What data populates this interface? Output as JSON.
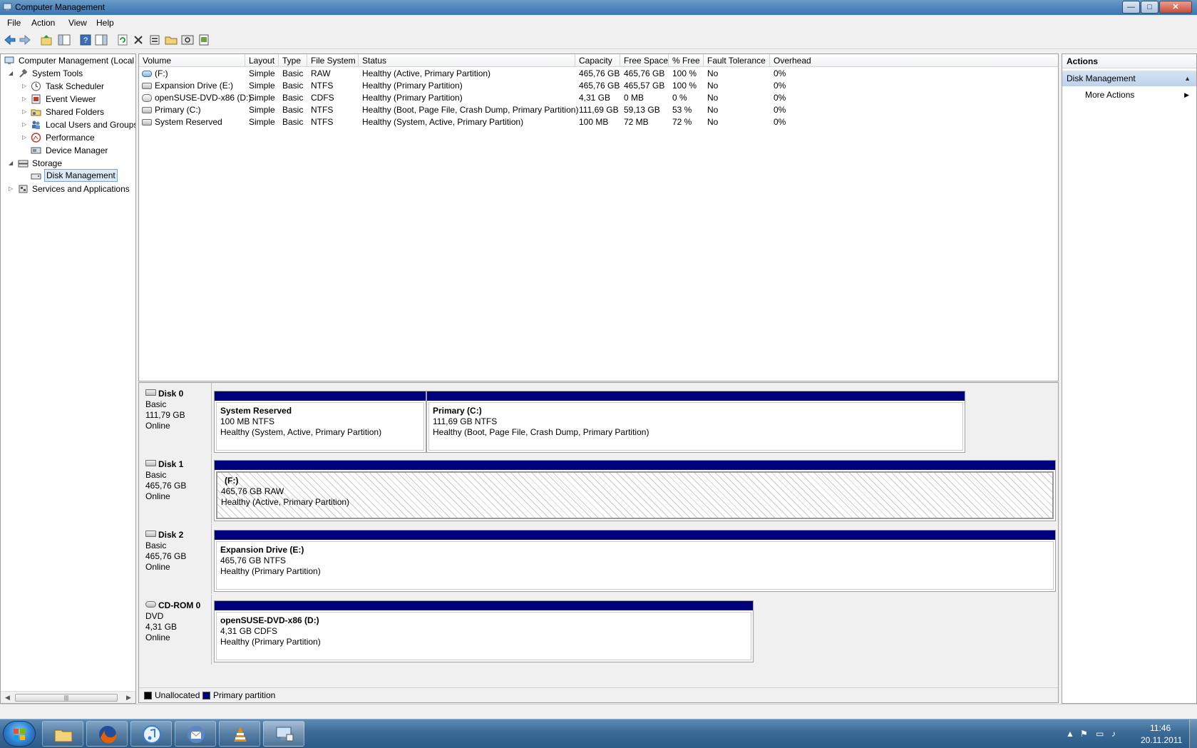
{
  "window": {
    "title": "Computer Management",
    "controls": {
      "minimize": "—",
      "maximize": "□",
      "close": "✕"
    }
  },
  "menu": [
    "File",
    "Action",
    "View",
    "Help"
  ],
  "toolbar_icons": [
    "back-icon",
    "forward-icon",
    "up-icon",
    "show-hide-tree-icon",
    "help-icon",
    "show-hide-action-icon",
    "refresh-icon",
    "delete-icon",
    "properties-icon",
    "open-icon",
    "search-icon",
    "export-icon"
  ],
  "tree": {
    "root": "Computer Management (Local",
    "items": [
      {
        "label": "System Tools",
        "level": 1,
        "expanded": true
      },
      {
        "label": "Task Scheduler",
        "level": 2
      },
      {
        "label": "Event Viewer",
        "level": 2
      },
      {
        "label": "Shared Folders",
        "level": 2
      },
      {
        "label": "Local Users and Groups",
        "level": 2
      },
      {
        "label": "Performance",
        "level": 2
      },
      {
        "label": "Device Manager",
        "level": 2
      },
      {
        "label": "Storage",
        "level": 1,
        "expanded": true
      },
      {
        "label": "Disk Management",
        "level": 2,
        "selected": true
      },
      {
        "label": "Services and Applications",
        "level": 1
      }
    ]
  },
  "volume_table": {
    "columns": [
      "Volume",
      "Layout",
      "Type",
      "File System",
      "Status",
      "Capacity",
      "Free Space",
      "% Free",
      "Fault Tolerance",
      "Overhead"
    ],
    "rows": [
      {
        "volume": "(F:)",
        "layout": "Simple",
        "type": "Basic",
        "fs": "RAW",
        "status": "Healthy (Active, Primary Partition)",
        "capacity": "465,76 GB",
        "free": "465,76 GB",
        "pct": "100 %",
        "fault": "No",
        "overhead": "0%",
        "icon": "raw"
      },
      {
        "volume": "Expansion Drive (E:)",
        "layout": "Simple",
        "type": "Basic",
        "fs": "NTFS",
        "status": "Healthy (Primary Partition)",
        "capacity": "465,76 GB",
        "free": "465,57 GB",
        "pct": "100 %",
        "fault": "No",
        "overhead": "0%",
        "icon": "disk"
      },
      {
        "volume": "openSUSE-DVD-x86 (D:)",
        "layout": "Simple",
        "type": "Basic",
        "fs": "CDFS",
        "status": "Healthy (Primary Partition)",
        "capacity": "4,31 GB",
        "free": "0 MB",
        "pct": "0 %",
        "fault": "No",
        "overhead": "0%",
        "icon": "cd"
      },
      {
        "volume": "Primary (C:)",
        "layout": "Simple",
        "type": "Basic",
        "fs": "NTFS",
        "status": "Healthy (Boot, Page File, Crash Dump, Primary Partition)",
        "capacity": "111,69 GB",
        "free": "59,13 GB",
        "pct": "53 %",
        "fault": "No",
        "overhead": "0%",
        "icon": "disk"
      },
      {
        "volume": "System Reserved",
        "layout": "Simple",
        "type": "Basic",
        "fs": "NTFS",
        "status": "Healthy (System, Active, Primary Partition)",
        "capacity": "100 MB",
        "free": "72 MB",
        "pct": "72 %",
        "fault": "No",
        "overhead": "0%",
        "icon": "disk"
      }
    ]
  },
  "disks": [
    {
      "name": "Disk 0",
      "type": "Basic",
      "size": "111,79 GB",
      "state": "Online",
      "partitions": [
        {
          "title": "System Reserved",
          "size": "100 MB NTFS",
          "status": "Healthy (System, Active, Primary Partition)"
        },
        {
          "title": "Primary  (C:)",
          "size": "111,69 GB NTFS",
          "status": "Healthy (Boot, Page File, Crash Dump, Primary Partition)"
        }
      ]
    },
    {
      "name": "Disk 1",
      "type": "Basic",
      "size": "465,76 GB",
      "state": "Online",
      "partitions": [
        {
          "title": "(F:)",
          "size": "465,76 GB RAW",
          "status": "Healthy (Active, Primary Partition)"
        }
      ]
    },
    {
      "name": "Disk 2",
      "type": "Basic",
      "size": "465,76 GB",
      "state": "Online",
      "partitions": [
        {
          "title": "Expansion Drive  (E:)",
          "size": "465,76 GB NTFS",
          "status": "Healthy (Primary Partition)"
        }
      ]
    },
    {
      "name": "CD-ROM 0",
      "type": "DVD",
      "size": "4,31 GB",
      "state": "Online",
      "partitions": [
        {
          "title": "openSUSE-DVD-x86  (D:)",
          "size": "4,31 GB CDFS",
          "status": "Healthy (Primary Partition)"
        }
      ]
    }
  ],
  "legend": [
    {
      "label": "Unallocated",
      "color": "#000000"
    },
    {
      "label": "Primary partition",
      "color": "#00007f"
    }
  ],
  "actions": {
    "title": "Actions",
    "section": "Disk Management",
    "item": "More Actions"
  },
  "taskbar": {
    "apps": [
      "windows-explorer-icon",
      "firefox-icon",
      "itunes-icon",
      "thunderbird-icon",
      "vlc-icon",
      "computer-management-icon"
    ],
    "time": "11:46",
    "date": "20.11.2011"
  }
}
